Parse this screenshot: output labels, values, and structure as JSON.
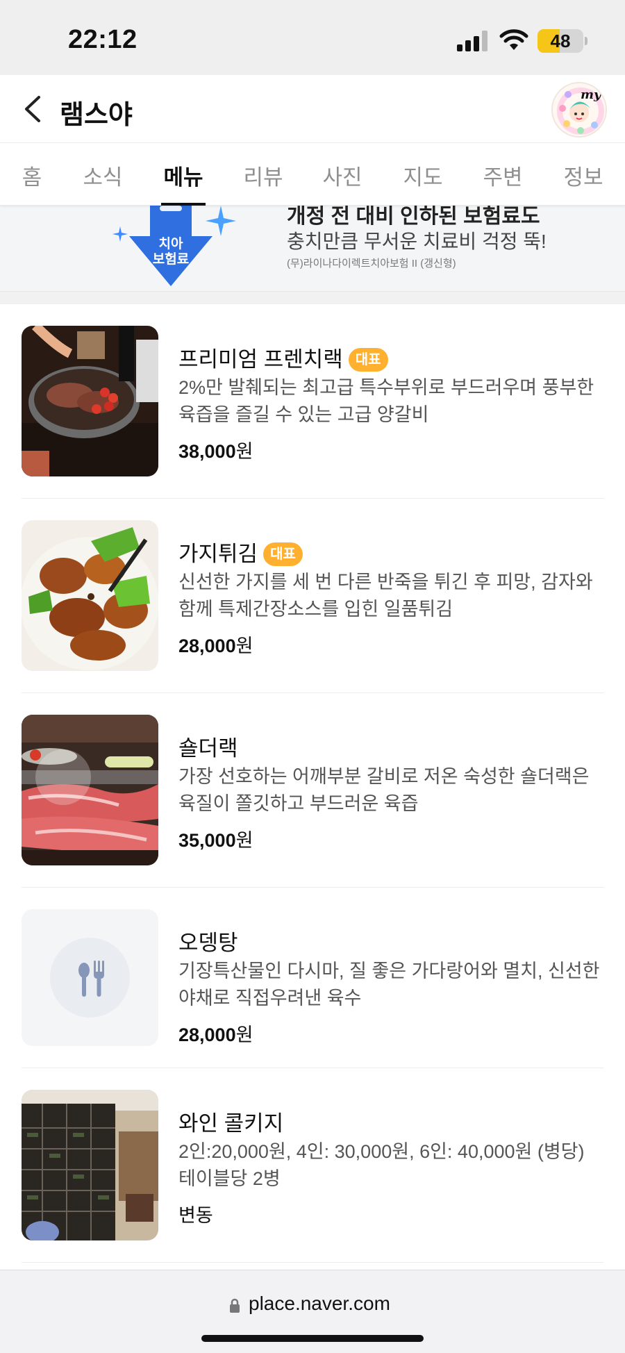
{
  "status_bar": {
    "time": "22:12",
    "battery": "48",
    "battery_level": 0.48
  },
  "header": {
    "title": "램스야",
    "avatar_label": "my"
  },
  "tabs": [
    {
      "label": "홈",
      "active": false
    },
    {
      "label": "소식",
      "active": false
    },
    {
      "label": "메뉴",
      "active": true
    },
    {
      "label": "리뷰",
      "active": false
    },
    {
      "label": "사진",
      "active": false
    },
    {
      "label": "지도",
      "active": false
    },
    {
      "label": "주변",
      "active": false
    },
    {
      "label": "정보",
      "active": false
    }
  ],
  "ad": {
    "headline": "개정 전 대비 인하된 보험료도",
    "subtext": "충치만큼 무서운 치료비 걱정 뚝!",
    "fine_print": "(무)라이나다이렉트치아보험 II (갱신형)",
    "badge_line1": "치아",
    "badge_line2": "보험료"
  },
  "menu": [
    {
      "name": "프리미엄 프렌치랙",
      "badge": "대표",
      "desc": "2%만 발췌되는 최고급 특수부위로 부드러우며 풍부한 육즙을 즐길 수 있는 고급 양갈비",
      "price": "38,000",
      "unit": "원",
      "image": "grilled-lamb-rack"
    },
    {
      "name": "가지튀김",
      "badge": "대표",
      "desc": "신선한 가지를 세 번 다른 반죽을 튀긴 후 피망, 감자와 함께 특제간장소스를 입힌 일품튀김",
      "price": "28,000",
      "unit": "원",
      "image": "fried-eggplant"
    },
    {
      "name": "숄더랙",
      "badge": "",
      "desc": "가장 선호하는 어깨부분 갈비로 저온 숙성한 숄더랙은 육질이 쫄깃하고 부드러운 육즙",
      "price": "35,000",
      "unit": "원",
      "image": "shoulder-rack-grill"
    },
    {
      "name": "오뎅탕",
      "badge": "",
      "desc": "기장특산물인 다시마, 질 좋은 가다랑어와 멸치, 신선한 야채로 직접우려낸 육수",
      "price": "28,000",
      "unit": "원",
      "image": "utensils-placeholder"
    },
    {
      "name": "와인 콜키지",
      "badge": "",
      "desc": "2인:20,000원, 4인: 30,000원, 6인: 40,000원 (병당) 테이블당 2병",
      "price": "",
      "unit": "변동",
      "image": "wine-shelf"
    }
  ],
  "url_bar": {
    "url": "place.naver.com"
  },
  "colors": {
    "badge": "#ffb02e",
    "ad_arrow": "#2f6fe0",
    "tab_active": "#111111"
  }
}
